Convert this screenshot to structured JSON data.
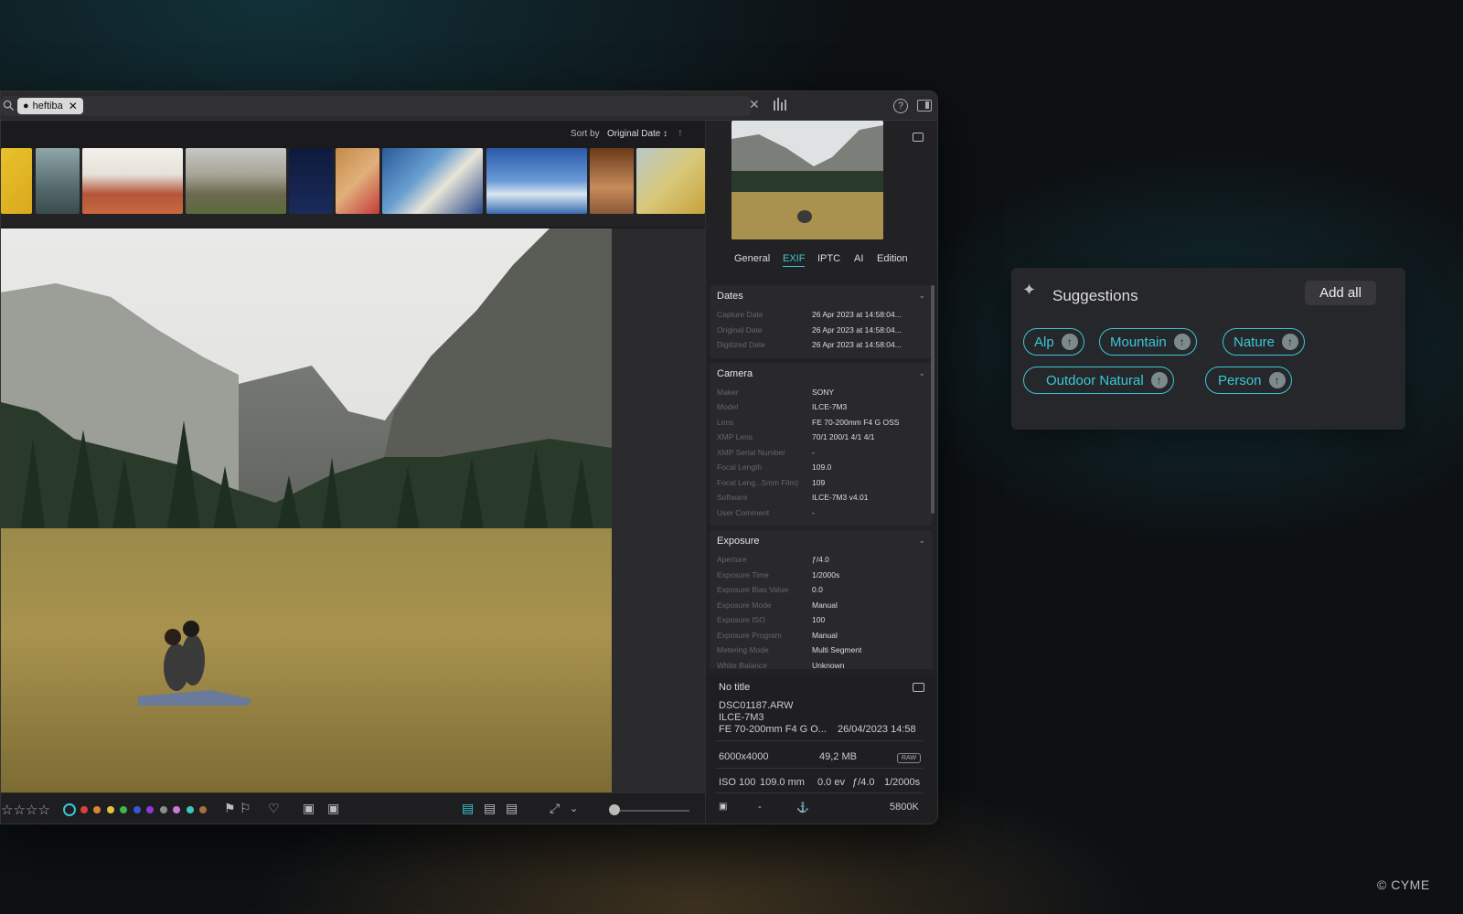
{
  "search": {
    "token": "heftiba",
    "placeholder": ""
  },
  "sortbar": {
    "label": "Sort by",
    "value": "Original Date ↕",
    "direction_icon": "↑"
  },
  "tabs": [
    "General",
    "EXIF",
    "IPTC",
    "AI",
    "Edition"
  ],
  "active_tab": "EXIF",
  "sections": [
    {
      "title": "Dates",
      "rows": [
        {
          "k": "Capture Date",
          "v": "26 Apr 2023 at 14:58:04..."
        },
        {
          "k": "Original Date",
          "v": "26 Apr 2023 at 14:58:04..."
        },
        {
          "k": "Digitized Date",
          "v": "26 Apr 2023 at 14:58:04..."
        }
      ]
    },
    {
      "title": "Camera",
      "rows": [
        {
          "k": "Maker",
          "v": "SONY"
        },
        {
          "k": "Model",
          "v": "ILCE-7M3"
        },
        {
          "k": "Lens",
          "v": "FE 70-200mm F4 G OSS"
        },
        {
          "k": "XMP Lens",
          "v": "70/1 200/1 4/1 4/1"
        },
        {
          "k": "XMP Serial Number",
          "v": "-"
        },
        {
          "k": "Focal Length",
          "v": "109.0"
        },
        {
          "k": "Focal Leng...5mm Film)",
          "v": "109"
        },
        {
          "k": "Software",
          "v": "ILCE-7M3 v4.01"
        },
        {
          "k": "User Comment",
          "v": "-"
        }
      ]
    },
    {
      "title": "Exposure",
      "rows": [
        {
          "k": "Aperture",
          "v": "ƒ/4.0"
        },
        {
          "k": "Exposure Time",
          "v": "1/2000s"
        },
        {
          "k": "Exposure Bias Value",
          "v": "0.0"
        },
        {
          "k": "Exposure Mode",
          "v": "Manual"
        },
        {
          "k": "Exposure ISO",
          "v": "100"
        },
        {
          "k": "Exposure Program",
          "v": "Manual"
        },
        {
          "k": "Metering Mode",
          "v": "Multi Segment"
        },
        {
          "k": "White Balance",
          "v": "Unknown"
        }
      ]
    }
  ],
  "info": {
    "title": "No title",
    "filename": "DSC01187.ARW",
    "model": "ILCE-7M3",
    "lens": "FE 70-200mm F4 G O...",
    "datetime": "26/04/2023 14:58",
    "dimensions": "6000x4000",
    "size": "49,2 MB",
    "badge": "RAW",
    "iso": "ISO 100",
    "focal": "109.0 mm",
    "ev": "0.0 ev",
    "aperture": "ƒ/4.0",
    "shutter": "1/2000s",
    "dash": "-",
    "wb": "5800K"
  },
  "suggestions": {
    "title": "Suggestions",
    "add_all": "Add all",
    "tags": [
      "Alp",
      "Mountain",
      "Nature",
      "Outdoor Natural",
      "Person"
    ]
  },
  "color_labels": [
    "#3ac7d6",
    "#d9413a",
    "#e0813a",
    "#e3c43a",
    "#3fb54a",
    "#3a55d6",
    "#8a3ad6",
    "#8c8c8c",
    "#c97ad6",
    "#3ac7c0",
    "#a37040"
  ],
  "copyright": "© CYME"
}
